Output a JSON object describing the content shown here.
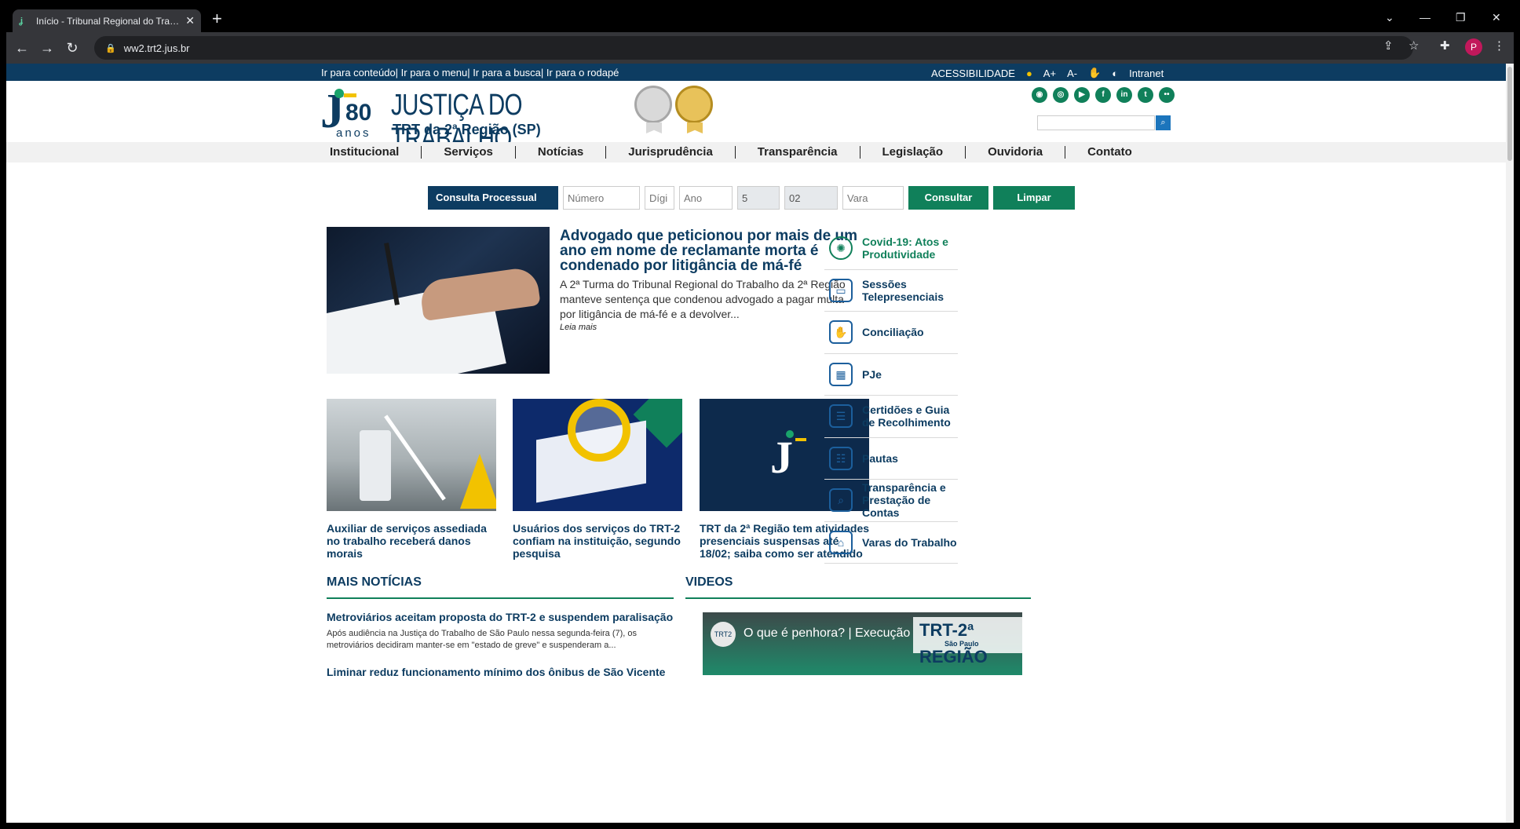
{
  "browser": {
    "tab_title": "Início - Tribunal Regional do Trabalho",
    "url": "ww2.trt2.jus.br",
    "profile_initial": "P"
  },
  "topbar": {
    "skip_links": "Ir para conteúdo| Ir para o menu| Ir para a busca| Ir para o rodapé",
    "accessibility": "ACESSIBILIDADE",
    "font_up": "A+",
    "font_down": "A-",
    "intranet": "Intranet"
  },
  "logo": {
    "number": "80",
    "anos": "anos",
    "title": "JUSTIÇA DO TRABALHO",
    "subtitle": "TRT da 2ª Região (SP)"
  },
  "social": [
    "rss-icon",
    "instagram-icon",
    "youtube-icon",
    "facebook-icon",
    "linkedin-icon",
    "twitter-icon",
    "flickr-icon"
  ],
  "nav": [
    "Institucional",
    "Serviços",
    "Notícias",
    "Jurisprudência",
    "Transparência",
    "Legislação",
    "Ouvidoria",
    "Contato"
  ],
  "consulta": {
    "label": "Consulta Processual",
    "numero": "Número",
    "digito": "Dígi",
    "ano": "Ano",
    "justica": "5",
    "tribunal": "02",
    "vara": "Vara",
    "consultar": "Consultar",
    "limpar": "Limpar"
  },
  "main_news": {
    "headline": "Advogado que peticionou por mais de um ano em nome de reclamante morta é condenado por litigância de má-fé",
    "summary": "A 2ª Turma do Tribunal Regional do Trabalho da 2ª Região manteve sentença que condenou advogado a pagar multa por litigância de má-fé e a devolver...",
    "more": "Leia mais"
  },
  "cards": [
    {
      "caption": "Auxiliar de serviços assediada no trabalho receberá danos morais"
    },
    {
      "caption": "Usuários dos serviços do TRT-2 confiam na instituição, segundo pesquisa"
    },
    {
      "caption": "TRT da 2ª Região tem atividades presenciais suspensas até 18/02; saiba como ser atendido"
    }
  ],
  "quick_links": [
    {
      "label": "Covid-19: Atos e Produtividade",
      "icon": "virus-icon"
    },
    {
      "label": "Sessões Telepresenciais",
      "icon": "video-conference-icon"
    },
    {
      "label": "Conciliação",
      "icon": "handshake-icon"
    },
    {
      "label": "PJe",
      "icon": "chip-icon"
    },
    {
      "label": "Certidões e Guia de Recolhimento",
      "icon": "certificate-icon"
    },
    {
      "label": "Pautas",
      "icon": "clipboard-icon"
    },
    {
      "label": "Transparência e Prestação de Contas",
      "icon": "monitor-search-icon"
    },
    {
      "label": "Varas do Trabalho",
      "icon": "building-icon"
    }
  ],
  "sections": {
    "mais_noticias": "MAIS NOTÍCIAS",
    "videos": "VIDEOS"
  },
  "more_news": [
    {
      "title": "Metroviários aceitam proposta do TRT-2 e suspendem paralisação",
      "summary": "Após audiência na Justiça do Trabalho de São Paulo nessa segunda-feira (7), os metroviários decidiram manter-se em \"estado de greve\" e suspenderam a..."
    },
    {
      "title": "Liminar reduz funcionamento mínimo dos ônibus de São Vicente"
    }
  ],
  "video": {
    "title": "O que é penhora? | Execução",
    "brand": "TRT-2ª REGIÃO",
    "brand_sub": "São Paulo"
  }
}
